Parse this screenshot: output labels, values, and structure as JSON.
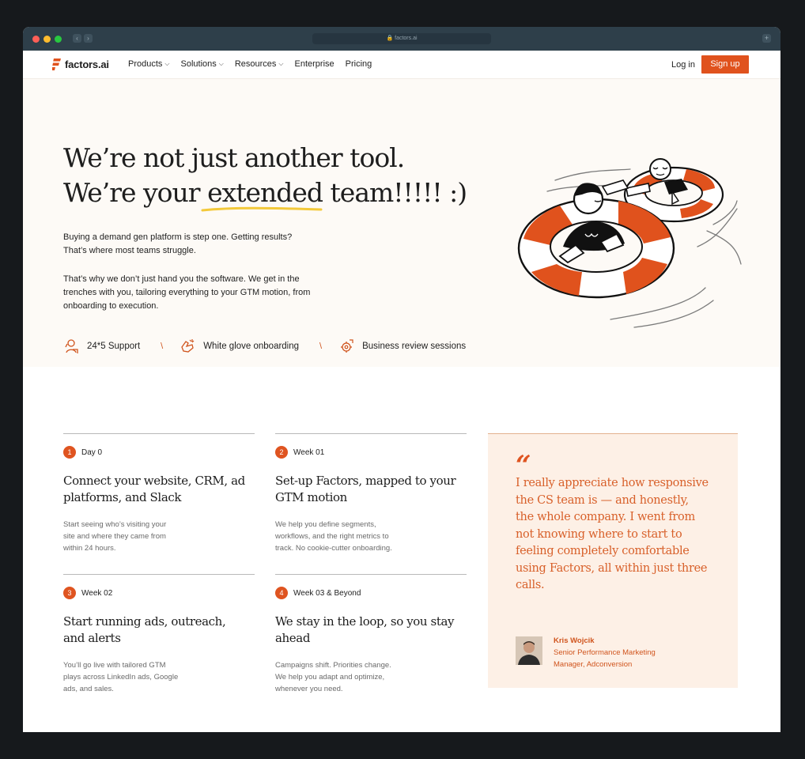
{
  "browser": {
    "url": "factors.ai"
  },
  "nav": {
    "brand": "factors.ai",
    "menu": [
      {
        "label": "Products",
        "dropdown": true
      },
      {
        "label": "Solutions",
        "dropdown": true
      },
      {
        "label": "Resources",
        "dropdown": true
      },
      {
        "label": "Enterprise",
        "dropdown": false
      },
      {
        "label": "Pricing",
        "dropdown": false
      }
    ],
    "login": "Log in",
    "signup": "Sign up"
  },
  "hero": {
    "title_line1": "We’re not just another tool.",
    "title_line2_pre": "We’re your ",
    "title_line2_highlight": "extended",
    "title_line2_post": " team!!!!! :)",
    "para1_line1": "Buying a demand gen platform is step one. Getting results?",
    "para1_line2": "That’s where most teams struggle.",
    "para2_line1": "That’s why we don’t just hand you the software. We get in the",
    "para2_line2": "trenches with you, tailoring everything to your GTM motion, from",
    "para2_line3": "onboarding to execution.",
    "features": [
      "24*5 Support",
      "White glove onboarding",
      "Business review sessions"
    ],
    "separator": "\\"
  },
  "steps": [
    {
      "num": "1",
      "tag": "Day 0",
      "title_line1": "Connect your website, CRM, ad",
      "title_line2": "platforms, and Slack",
      "desc_line1": "Start seeing who’s visiting your",
      "desc_line2": "site and where they came from",
      "desc_line3": "within 24 hours."
    },
    {
      "num": "2",
      "tag": "Week 01",
      "title_line1": "Set-up Factors, mapped to your",
      "title_line2": "GTM motion",
      "desc_line1": "We help you define segments,",
      "desc_line2": "workflows, and the right metrics to",
      "desc_line3": "track. No cookie-cutter onboarding."
    },
    {
      "num": "3",
      "tag": "Week 02",
      "title_line1": "Start running ads, outreach,",
      "title_line2": "and alerts",
      "desc_line1": "You’ll go live with tailored GTM",
      "desc_line2": "plays across LinkedIn ads, Google",
      "desc_line3": "ads, and sales."
    },
    {
      "num": "4",
      "tag": "Week 03 & Beyond",
      "title_line1": "We stay in the loop, so you stay",
      "title_line2": "ahead",
      "desc_line1": "Campaigns shift. Priorities change.",
      "desc_line2": "We help you adapt and optimize,",
      "desc_line3": "whenever you need."
    }
  ],
  "testimonial": {
    "mark": "“",
    "lines": [
      "I really appreciate how responsive",
      "the CS team is — and honestly,",
      "the whole company. I went from",
      "not knowing where to start to",
      "feeling completely comfortable",
      "using Factors, all within just three",
      "calls."
    ],
    "author_name": "Kris Wojcik",
    "author_role_line1": "Senior Performance Marketing",
    "author_role_line2": "Manager, Adconversion"
  },
  "colors": {
    "accent": "#e0521d",
    "hero_bg": "#fdfaf6",
    "quote_bg": "#fdf0e6"
  }
}
